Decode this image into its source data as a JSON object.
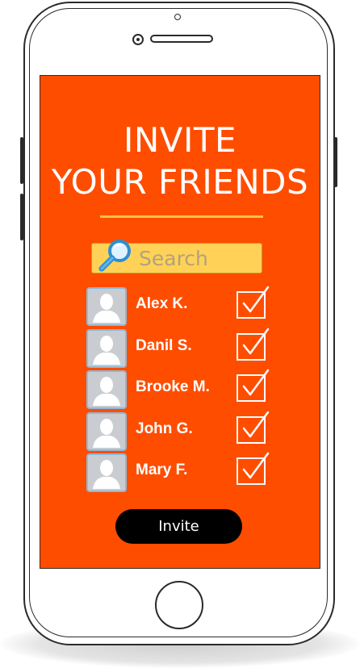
{
  "screen": {
    "title_line1": "INVITE",
    "title_line2": "YOUR FRIENDS",
    "background_color": "#ff4d00",
    "accent_color": "#f5c242"
  },
  "search": {
    "placeholder": "Search",
    "icon": "magnifier-icon"
  },
  "friends": [
    {
      "name": "Alex K.",
      "checked": true
    },
    {
      "name": "Danil S.",
      "checked": true
    },
    {
      "name": "Brooke M.",
      "checked": true
    },
    {
      "name": "John G.",
      "checked": true
    },
    {
      "name": "Mary F.",
      "checked": true
    }
  ],
  "invite_button": {
    "label": "Invite"
  }
}
